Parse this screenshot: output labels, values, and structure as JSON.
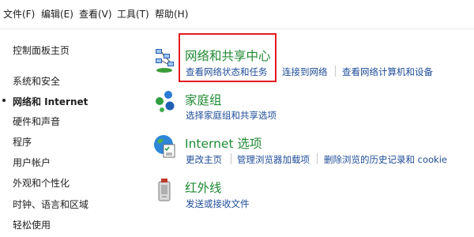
{
  "menubar": {
    "items": [
      {
        "label": "文件(F)"
      },
      {
        "label": "编辑(E)"
      },
      {
        "label": "查看(V)"
      },
      {
        "label": "工具(T)"
      },
      {
        "label": "帮助(H)"
      }
    ]
  },
  "sidebar": {
    "home": "控制面板主页",
    "items": [
      {
        "label": "系统和安全"
      },
      {
        "label": "网络和 Internet",
        "active": true
      },
      {
        "label": "硬件和声音"
      },
      {
        "label": "程序"
      },
      {
        "label": "用户帐户"
      },
      {
        "label": "外观和个性化"
      },
      {
        "label": "时钟、语言和区域"
      },
      {
        "label": "轻松使用"
      }
    ]
  },
  "categories": [
    {
      "icon": "network-icon",
      "title": "网络和共享中心",
      "links": [
        "查看网络状态和任务",
        "连接到网络",
        "查看网络计算机和设备"
      ]
    },
    {
      "icon": "homegroup-icon",
      "title": "家庭组",
      "links": [
        "选择家庭组和共享选项"
      ]
    },
    {
      "icon": "internet-options-icon",
      "title": "Internet 选项",
      "links": [
        "更改主页",
        "管理浏览器加载项",
        "删除浏览的历史记录和 cookie"
      ]
    },
    {
      "icon": "infrared-icon",
      "title": "红外线",
      "links": [
        "发送或接收文件"
      ]
    }
  ],
  "colors": {
    "title_green": "#1f8a33",
    "link_blue": "#1e4c98",
    "highlight_red": "#e21b22"
  }
}
